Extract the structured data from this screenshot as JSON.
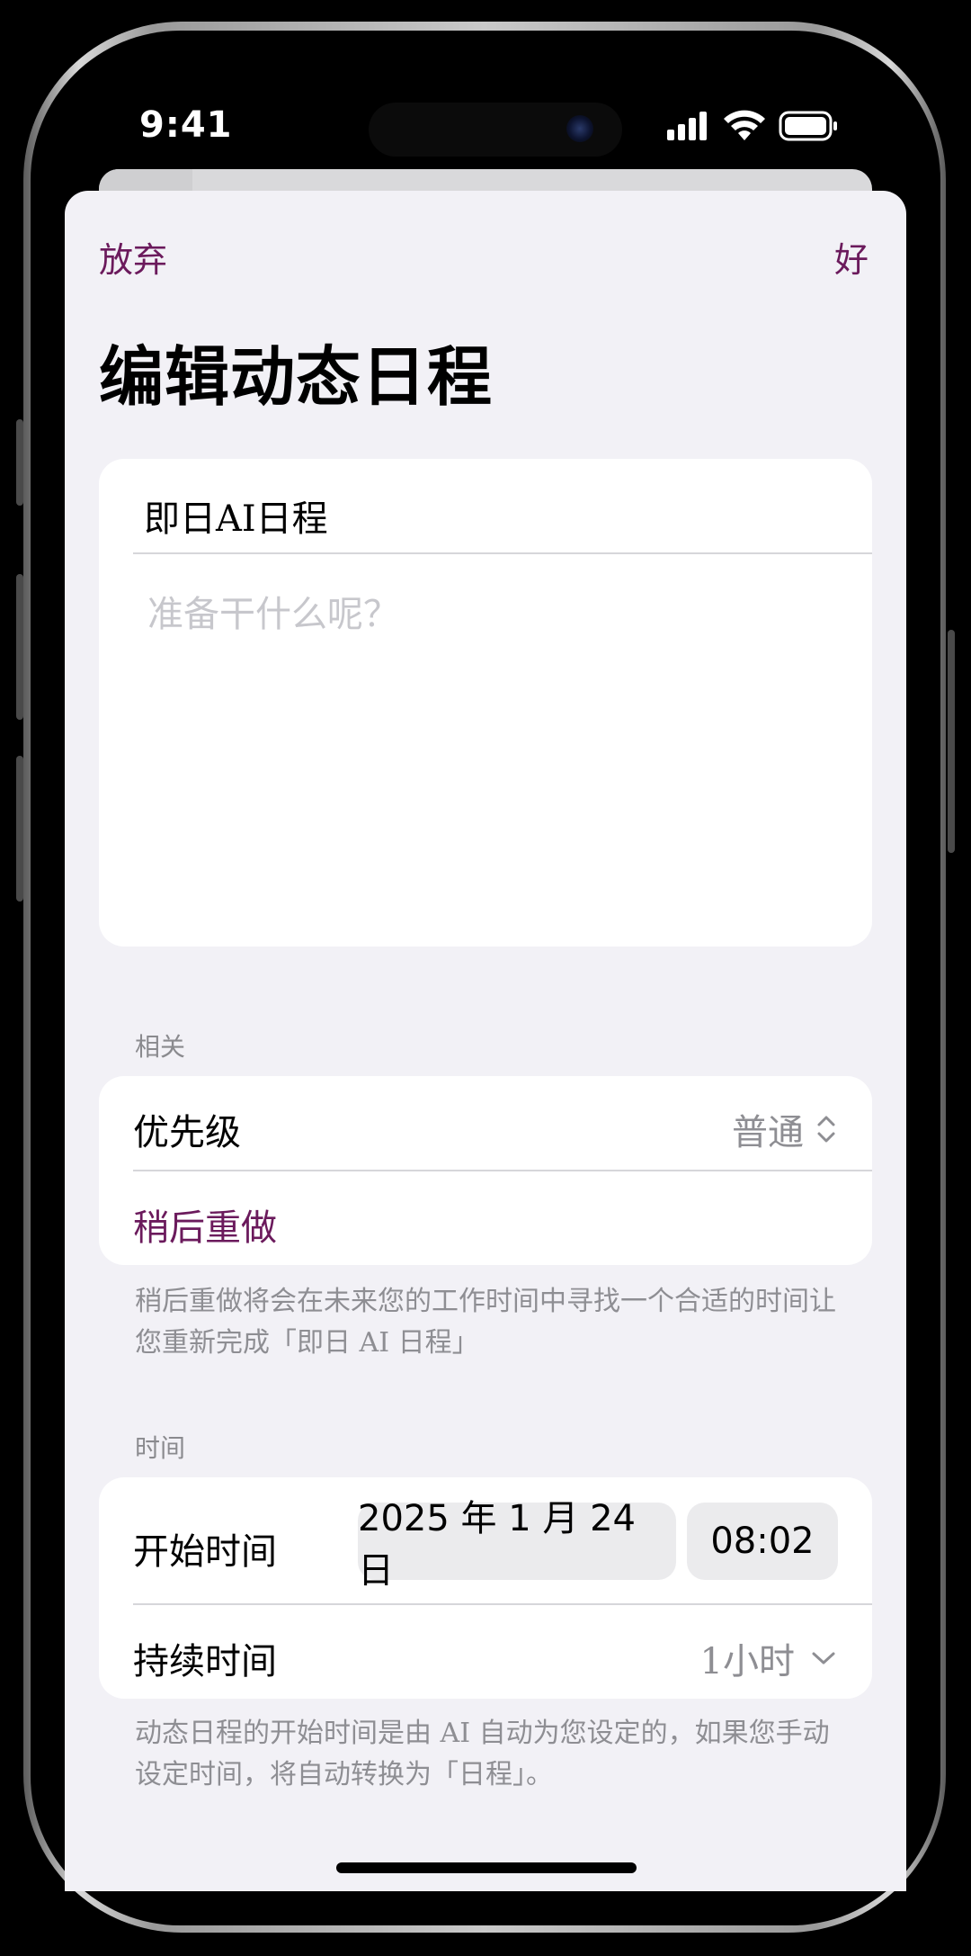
{
  "status_bar": {
    "time": "9:41"
  },
  "nav": {
    "cancel_label": "放弃",
    "done_label": "好"
  },
  "page_title": "编辑动态日程",
  "task": {
    "title": "即日AI日程",
    "notes_placeholder": "准备干什么呢？"
  },
  "related": {
    "section_label": "相关",
    "priority_label": "优先级",
    "priority_value": "普通",
    "redo_label": "稍后重做",
    "footnote": "稍后重做将会在未来您的工作时间中寻找一个合适的时间让您重新完成「即日 AI 日程」"
  },
  "time": {
    "section_label": "时间",
    "start_label": "开始时间",
    "start_date": "2025 年 1 月 24 日",
    "start_time": "08:02",
    "duration_label": "持续时间",
    "duration_value": "1小时",
    "footnote": "动态日程的开始时间是由 AI 自动为您设定的，如果您手动设定时间，将自动转换为「日程」。"
  },
  "colors": {
    "accent": "#6b1a5c",
    "background": "#f2f1f6",
    "card": "#ffffff"
  }
}
